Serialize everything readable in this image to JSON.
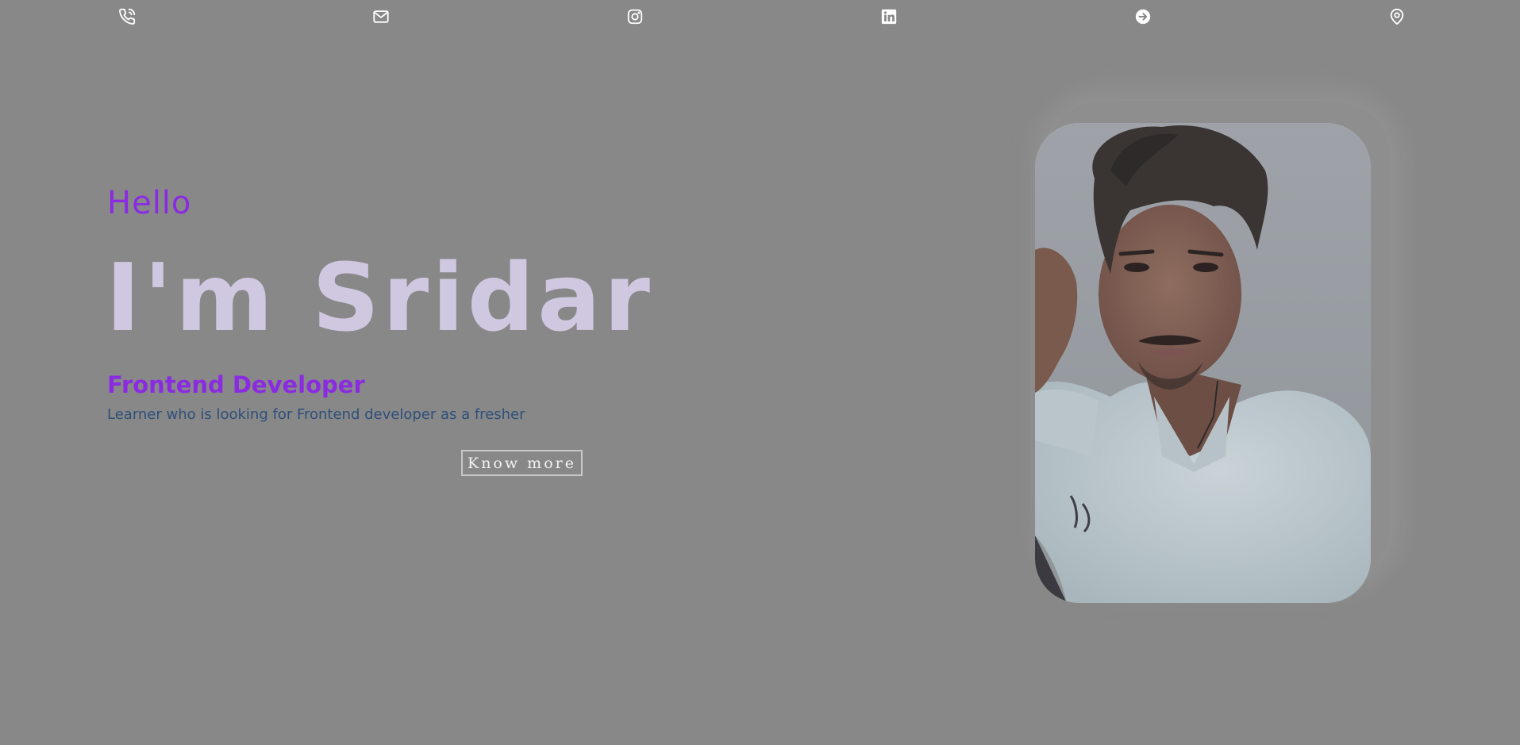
{
  "nav_icons": [
    {
      "name": "phone-icon"
    },
    {
      "name": "mail-icon"
    },
    {
      "name": "instagram-icon"
    },
    {
      "name": "linkedin-icon"
    },
    {
      "name": "arrow-right-circle-icon"
    },
    {
      "name": "location-pin-icon"
    }
  ],
  "hero": {
    "greeting": "Hello",
    "name": "I'm Sridar",
    "role": "Frontend Developer",
    "description": "Learner who is looking for Frontend developer as a fresher",
    "cta_label": "Know more"
  },
  "colors": {
    "background": "#888888",
    "accent": "#8a2be2",
    "name_text": "#cfc8e0",
    "description_text": "#2f4f7a"
  }
}
